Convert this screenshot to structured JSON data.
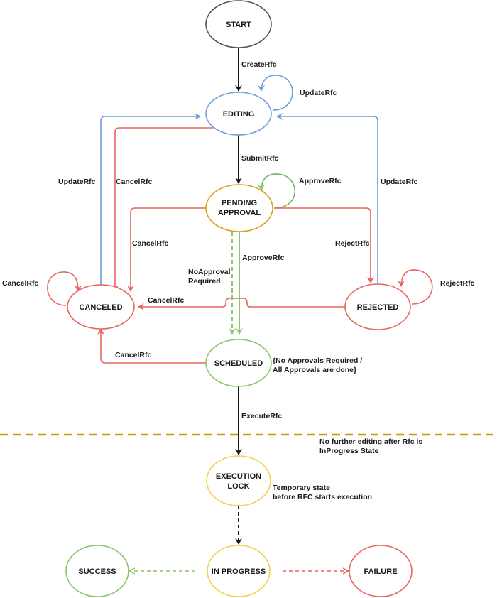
{
  "colors": {
    "black": "#1a1a1a",
    "gray": "#555555",
    "blue": "#6c9fdc",
    "red": "#e8655f",
    "green": "#8cc66a",
    "greenDark": "#72b45a",
    "orange": "#d7a11c",
    "yellow": "#f5cf4d",
    "divider": "#cc9a06"
  },
  "nodes": {
    "start": {
      "label": "START"
    },
    "editing": {
      "label": "EDITING"
    },
    "pending": {
      "line1": "PENDING",
      "line2": "APPROVAL"
    },
    "canceled": {
      "label": "CANCELED"
    },
    "rejected": {
      "label": "REJECTED"
    },
    "scheduled": {
      "label": "SCHEDULED"
    },
    "execution_lock": {
      "line1": "EXECUTION",
      "line2": "LOCK"
    },
    "in_progress": {
      "label": "IN PROGRESS"
    },
    "success": {
      "label": "SUCCESS"
    },
    "failure": {
      "label": "FAILURE"
    }
  },
  "edges": {
    "create": "CreateRfc",
    "update_self": "UpdateRfc",
    "submit": "SubmitRfc",
    "approve_self": "ApproveRfc",
    "update_left": "UpdateRfc",
    "cancel_editing": "CancelRfc",
    "cancel_pending": "CancelRfc",
    "update_right": "UpdateRfc",
    "reject": "RejectRfc",
    "reject_self": "RejectRfc",
    "cancel_self": "CancelRfc",
    "cancel_rejected": "CancelRfc",
    "no_approval_1": "NoApproval",
    "no_approval_2": "Required",
    "approve": "ApproveRfc",
    "cancel_scheduled": "CancelRfc",
    "execute": "ExecuteRfc"
  },
  "notes": {
    "scheduled_1": "{No Approvals Required /",
    "scheduled_2": "All Approvals are done}",
    "divider_1": "No further editing after Rfc is",
    "divider_2": "InProgress State",
    "lock_1": "Temporary state",
    "lock_2": "before RFC starts execution"
  }
}
